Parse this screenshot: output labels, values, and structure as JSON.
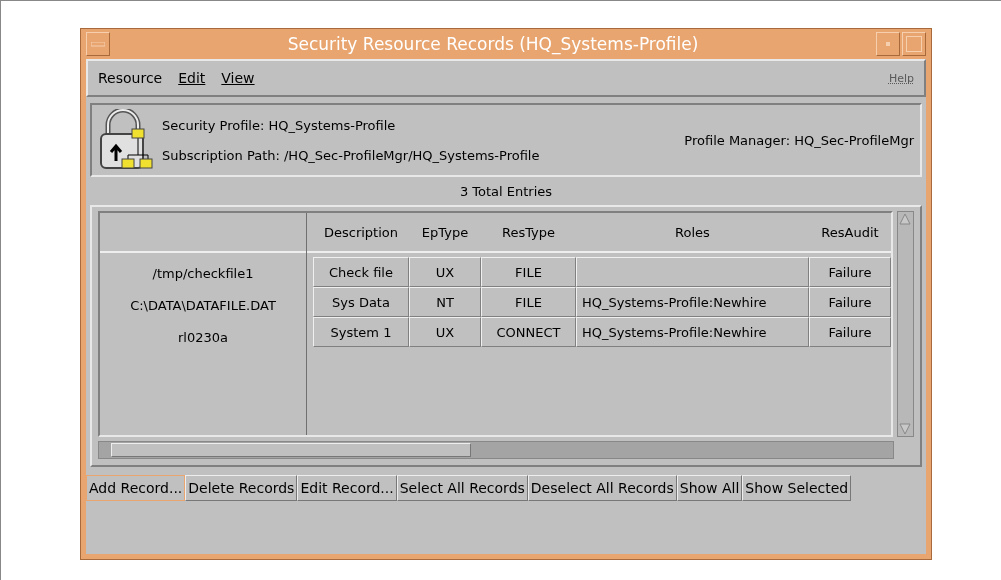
{
  "window": {
    "title": "Security Resource Records (HQ_Systems-Profile)"
  },
  "menu": [
    {
      "label": "Resource",
      "underline": false,
      "disabled": false
    },
    {
      "label": "Edit",
      "underline": true,
      "disabled": false
    },
    {
      "label": "View",
      "underline": true,
      "disabled": false
    },
    {
      "label": "Help",
      "underline": true,
      "disabled": true
    }
  ],
  "header": {
    "security_profile": "Security Profile: HQ_Systems-Profile",
    "subscription_path": "Subscription Path: /HQ_Sec-ProfileMgr/HQ_Systems-Profile",
    "profile_manager": "Profile Manager: HQ_Sec-ProfileMgr"
  },
  "total_entries": "3 Total Entries",
  "table": {
    "columns": [
      "Description",
      "EpType",
      "ResType",
      "Roles",
      "ResAudit"
    ],
    "rows": [
      {
        "name": "/tmp/checkfile1",
        "cells": [
          "Check file",
          "UX",
          "FILE",
          "",
          "Failure"
        ]
      },
      {
        "name": "C:\\DATA\\DATAFILE.DAT",
        "cells": [
          "Sys Data",
          "NT",
          "FILE",
          "HQ_Systems-Profile:Newhire",
          "Failure"
        ]
      },
      {
        "name": "rl0230a",
        "cells": [
          "System 1",
          "UX",
          "CONNECT",
          "HQ_Systems-Profile:Newhire",
          "Failure"
        ]
      }
    ]
  },
  "buttons": [
    {
      "label": "Add Record...",
      "focused": true
    },
    {
      "label": "Delete Records",
      "focused": false
    },
    {
      "label": "Edit Record...",
      "focused": false
    },
    {
      "label": "Select All Records",
      "focused": false
    },
    {
      "label": "Deselect All Records",
      "focused": false
    },
    {
      "label": "Show All",
      "focused": false
    },
    {
      "label": "Show Selected",
      "focused": false
    }
  ]
}
